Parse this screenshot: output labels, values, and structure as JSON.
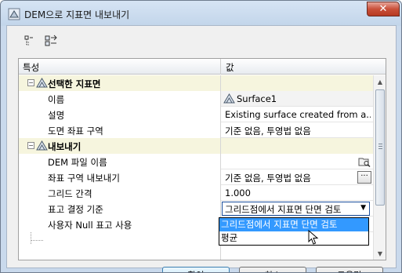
{
  "window": {
    "title": "DEM으로 지표면 내보내기",
    "close_glyph": "✕"
  },
  "grid": {
    "col_property": "특성",
    "col_value": "값",
    "categories": [
      {
        "label": "선택한 지표면",
        "expander": "−",
        "properties": [
          {
            "label": "이름",
            "value": "Surface1"
          },
          {
            "label": "설명",
            "value": "Existing surface created from a..."
          },
          {
            "label": "도면 좌표 구역",
            "value": "기준 없음, 투영법 없음"
          }
        ]
      },
      {
        "label": "내보내기",
        "expander": "−",
        "properties": [
          {
            "label": "DEM 파일 이름",
            "value": ""
          },
          {
            "label": "좌표 구역 내보내기",
            "value": "기준 없음, 투영법 없음"
          },
          {
            "label": "그리드 간격",
            "value": "1.000"
          },
          {
            "label": "표고 결정 기준",
            "value": "그리드점에서 지표면 단면 검토"
          },
          {
            "label": "사용자 Null 표고 사용",
            "value": ""
          }
        ]
      }
    ]
  },
  "dropdown": {
    "options": [
      "그리드점에서 지표면 단면 검토",
      "평균"
    ],
    "selected_index": 0,
    "arrow": "▼"
  },
  "buttons": {
    "ok": "확인",
    "cancel": "취소",
    "help": "도움말"
  },
  "icons": {
    "app": "app-icon",
    "toolbar_1": "categorized-view-icon",
    "toolbar_2": "alphabetical-view-icon",
    "category": "surface-triangle-icon",
    "surface_item": "surface-icon",
    "browse": "browse-folder-icon",
    "ellipsis_glyph": "···"
  },
  "colors": {
    "category_bg": "#f6f5de",
    "selection": "#3399ff",
    "close": "#c9503a"
  }
}
